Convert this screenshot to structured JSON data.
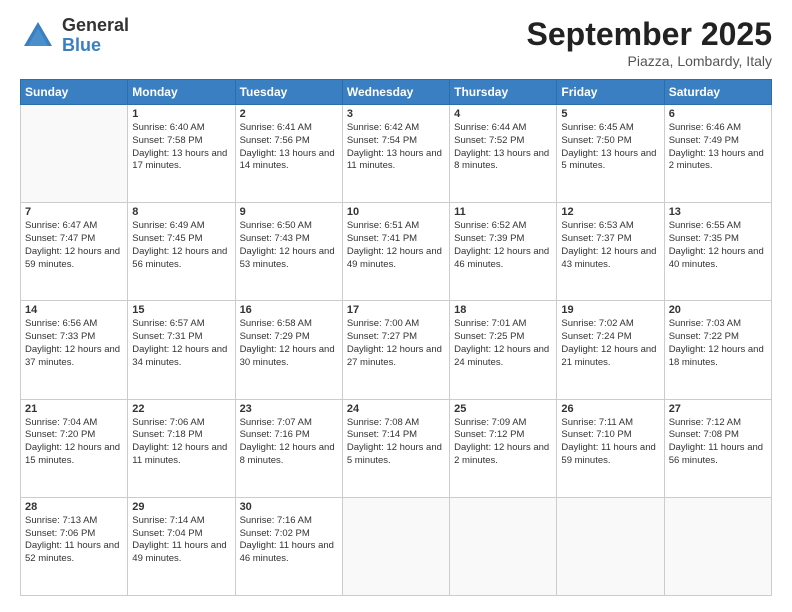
{
  "logo": {
    "general": "General",
    "blue": "Blue"
  },
  "title": "September 2025",
  "location": "Piazza, Lombardy, Italy",
  "days_header": [
    "Sunday",
    "Monday",
    "Tuesday",
    "Wednesday",
    "Thursday",
    "Friday",
    "Saturday"
  ],
  "weeks": [
    [
      {
        "day": "",
        "sunrise": "",
        "sunset": "",
        "daylight": ""
      },
      {
        "day": "1",
        "sunrise": "Sunrise: 6:40 AM",
        "sunset": "Sunset: 7:58 PM",
        "daylight": "Daylight: 13 hours and 17 minutes."
      },
      {
        "day": "2",
        "sunrise": "Sunrise: 6:41 AM",
        "sunset": "Sunset: 7:56 PM",
        "daylight": "Daylight: 13 hours and 14 minutes."
      },
      {
        "day": "3",
        "sunrise": "Sunrise: 6:42 AM",
        "sunset": "Sunset: 7:54 PM",
        "daylight": "Daylight: 13 hours and 11 minutes."
      },
      {
        "day": "4",
        "sunrise": "Sunrise: 6:44 AM",
        "sunset": "Sunset: 7:52 PM",
        "daylight": "Daylight: 13 hours and 8 minutes."
      },
      {
        "day": "5",
        "sunrise": "Sunrise: 6:45 AM",
        "sunset": "Sunset: 7:50 PM",
        "daylight": "Daylight: 13 hours and 5 minutes."
      },
      {
        "day": "6",
        "sunrise": "Sunrise: 6:46 AM",
        "sunset": "Sunset: 7:49 PM",
        "daylight": "Daylight: 13 hours and 2 minutes."
      }
    ],
    [
      {
        "day": "7",
        "sunrise": "Sunrise: 6:47 AM",
        "sunset": "Sunset: 7:47 PM",
        "daylight": "Daylight: 12 hours and 59 minutes."
      },
      {
        "day": "8",
        "sunrise": "Sunrise: 6:49 AM",
        "sunset": "Sunset: 7:45 PM",
        "daylight": "Daylight: 12 hours and 56 minutes."
      },
      {
        "day": "9",
        "sunrise": "Sunrise: 6:50 AM",
        "sunset": "Sunset: 7:43 PM",
        "daylight": "Daylight: 12 hours and 53 minutes."
      },
      {
        "day": "10",
        "sunrise": "Sunrise: 6:51 AM",
        "sunset": "Sunset: 7:41 PM",
        "daylight": "Daylight: 12 hours and 49 minutes."
      },
      {
        "day": "11",
        "sunrise": "Sunrise: 6:52 AM",
        "sunset": "Sunset: 7:39 PM",
        "daylight": "Daylight: 12 hours and 46 minutes."
      },
      {
        "day": "12",
        "sunrise": "Sunrise: 6:53 AM",
        "sunset": "Sunset: 7:37 PM",
        "daylight": "Daylight: 12 hours and 43 minutes."
      },
      {
        "day": "13",
        "sunrise": "Sunrise: 6:55 AM",
        "sunset": "Sunset: 7:35 PM",
        "daylight": "Daylight: 12 hours and 40 minutes."
      }
    ],
    [
      {
        "day": "14",
        "sunrise": "Sunrise: 6:56 AM",
        "sunset": "Sunset: 7:33 PM",
        "daylight": "Daylight: 12 hours and 37 minutes."
      },
      {
        "day": "15",
        "sunrise": "Sunrise: 6:57 AM",
        "sunset": "Sunset: 7:31 PM",
        "daylight": "Daylight: 12 hours and 34 minutes."
      },
      {
        "day": "16",
        "sunrise": "Sunrise: 6:58 AM",
        "sunset": "Sunset: 7:29 PM",
        "daylight": "Daylight: 12 hours and 30 minutes."
      },
      {
        "day": "17",
        "sunrise": "Sunrise: 7:00 AM",
        "sunset": "Sunset: 7:27 PM",
        "daylight": "Daylight: 12 hours and 27 minutes."
      },
      {
        "day": "18",
        "sunrise": "Sunrise: 7:01 AM",
        "sunset": "Sunset: 7:25 PM",
        "daylight": "Daylight: 12 hours and 24 minutes."
      },
      {
        "day": "19",
        "sunrise": "Sunrise: 7:02 AM",
        "sunset": "Sunset: 7:24 PM",
        "daylight": "Daylight: 12 hours and 21 minutes."
      },
      {
        "day": "20",
        "sunrise": "Sunrise: 7:03 AM",
        "sunset": "Sunset: 7:22 PM",
        "daylight": "Daylight: 12 hours and 18 minutes."
      }
    ],
    [
      {
        "day": "21",
        "sunrise": "Sunrise: 7:04 AM",
        "sunset": "Sunset: 7:20 PM",
        "daylight": "Daylight: 12 hours and 15 minutes."
      },
      {
        "day": "22",
        "sunrise": "Sunrise: 7:06 AM",
        "sunset": "Sunset: 7:18 PM",
        "daylight": "Daylight: 12 hours and 11 minutes."
      },
      {
        "day": "23",
        "sunrise": "Sunrise: 7:07 AM",
        "sunset": "Sunset: 7:16 PM",
        "daylight": "Daylight: 12 hours and 8 minutes."
      },
      {
        "day": "24",
        "sunrise": "Sunrise: 7:08 AM",
        "sunset": "Sunset: 7:14 PM",
        "daylight": "Daylight: 12 hours and 5 minutes."
      },
      {
        "day": "25",
        "sunrise": "Sunrise: 7:09 AM",
        "sunset": "Sunset: 7:12 PM",
        "daylight": "Daylight: 12 hours and 2 minutes."
      },
      {
        "day": "26",
        "sunrise": "Sunrise: 7:11 AM",
        "sunset": "Sunset: 7:10 PM",
        "daylight": "Daylight: 11 hours and 59 minutes."
      },
      {
        "day": "27",
        "sunrise": "Sunrise: 7:12 AM",
        "sunset": "Sunset: 7:08 PM",
        "daylight": "Daylight: 11 hours and 56 minutes."
      }
    ],
    [
      {
        "day": "28",
        "sunrise": "Sunrise: 7:13 AM",
        "sunset": "Sunset: 7:06 PM",
        "daylight": "Daylight: 11 hours and 52 minutes."
      },
      {
        "day": "29",
        "sunrise": "Sunrise: 7:14 AM",
        "sunset": "Sunset: 7:04 PM",
        "daylight": "Daylight: 11 hours and 49 minutes."
      },
      {
        "day": "30",
        "sunrise": "Sunrise: 7:16 AM",
        "sunset": "Sunset: 7:02 PM",
        "daylight": "Daylight: 11 hours and 46 minutes."
      },
      {
        "day": "",
        "sunrise": "",
        "sunset": "",
        "daylight": ""
      },
      {
        "day": "",
        "sunrise": "",
        "sunset": "",
        "daylight": ""
      },
      {
        "day": "",
        "sunrise": "",
        "sunset": "",
        "daylight": ""
      },
      {
        "day": "",
        "sunrise": "",
        "sunset": "",
        "daylight": ""
      }
    ]
  ]
}
